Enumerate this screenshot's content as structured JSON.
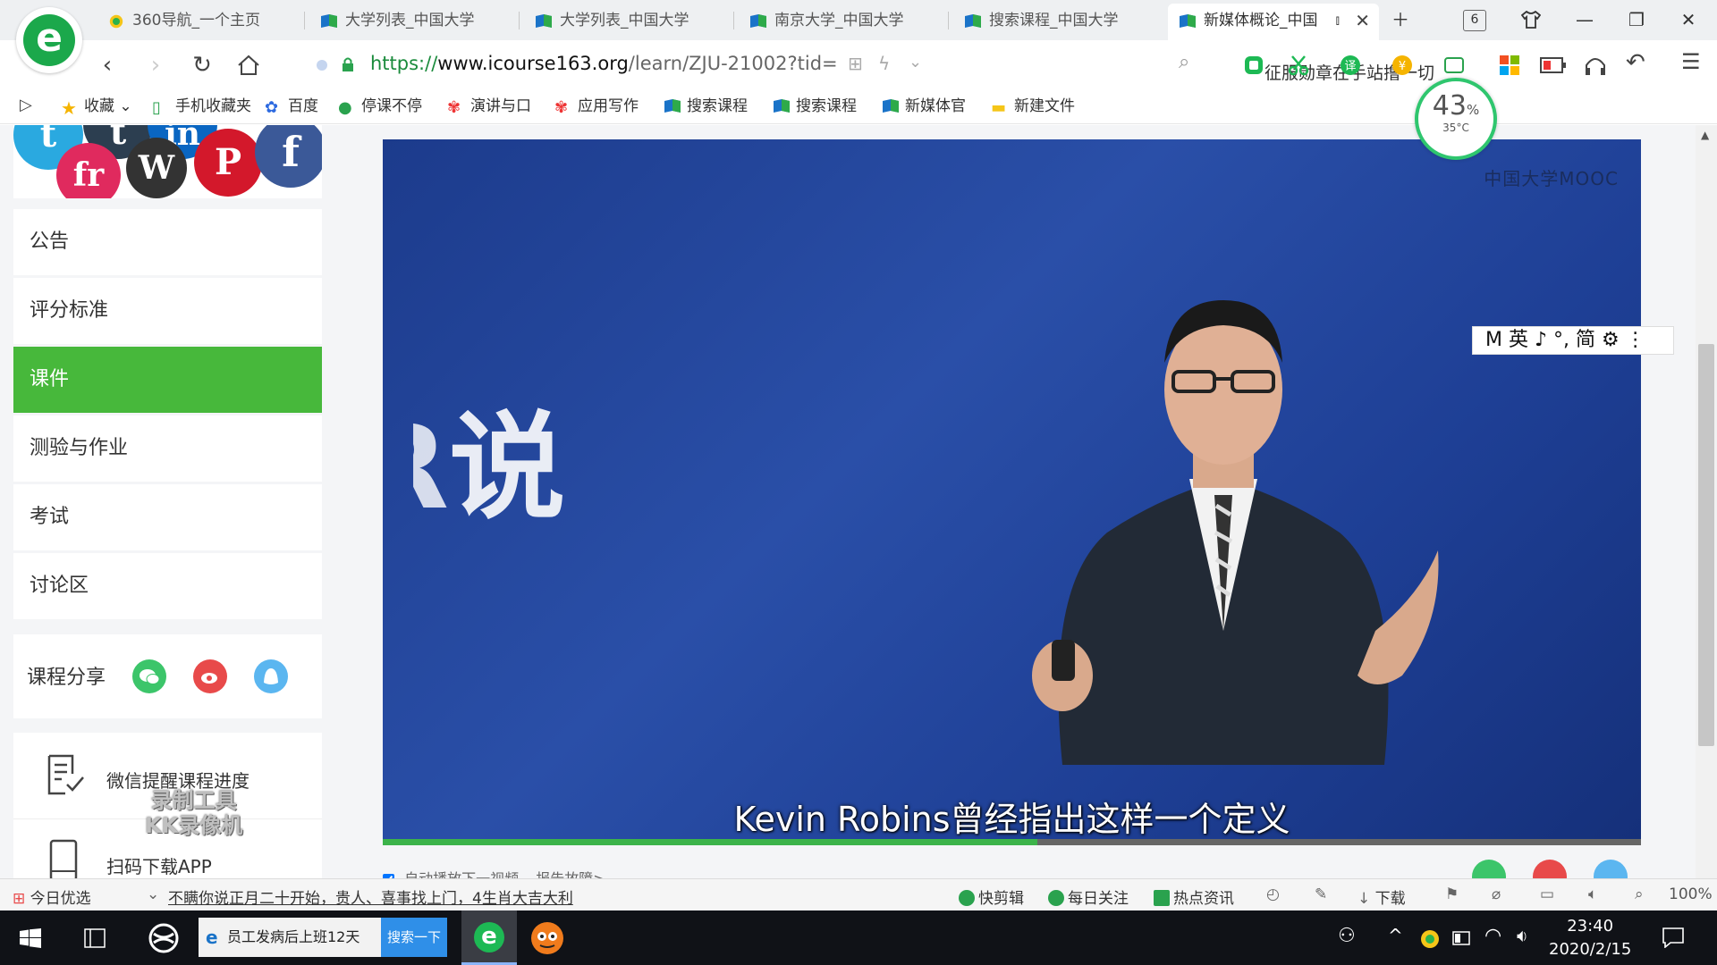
{
  "browser": {
    "tabs": [
      {
        "title": "360导航_一个主页",
        "active": false
      },
      {
        "title": "大学列表_中国大学",
        "active": false
      },
      {
        "title": "大学列表_中国大学",
        "active": false
      },
      {
        "title": "南京大学_中国大学",
        "active": false
      },
      {
        "title": "搜索课程_中国大学",
        "active": false
      },
      {
        "title": "新媒体概论_中国",
        "active": true
      }
    ],
    "tab_count": "6",
    "url_scheme": "https://",
    "url_host": "www.icourse163.org",
    "url_path": "/learn/ZJU-21002?tid=",
    "search_hint": "征服勋章在手站撸一切",
    "bookmarks": [
      "收藏",
      "手机收藏夹",
      "百度",
      "停课不停",
      "演讲与口",
      "应用写作",
      "搜索课程",
      "搜索课程",
      "新媒体官",
      "新建文件"
    ],
    "perf": {
      "percent": "43",
      "percent_sign": "%",
      "temp": "35°C"
    }
  },
  "sidebar": {
    "menu": [
      {
        "label": "公告",
        "active": false
      },
      {
        "label": "评分标准",
        "active": false
      },
      {
        "label": "课件",
        "active": true
      },
      {
        "label": "测验与作业",
        "active": false
      },
      {
        "label": "考试",
        "active": false
      },
      {
        "label": "讨论区",
        "active": false
      }
    ],
    "share_label": "课程分享",
    "wechat_remind": "微信提醒课程进度",
    "download_app": "扫码下载APP",
    "watermark_line1": "录制工具",
    "watermark_line2": "KK录像机"
  },
  "video": {
    "bg_text": "说",
    "bg_text_partial": "R",
    "logo": "中国大学MOOC",
    "subtitle": "Kevin Robins曾经指出这样一个定义",
    "progress": 0.52,
    "autoplay_label": "自动播放下一视频",
    "report_label": "报告故障>"
  },
  "ime": {
    "text": "M 英 ♪ °, 简 ⚙ ⋮"
  },
  "statusbar": {
    "today": "今日优选",
    "headline": "不瞒你说正月二十开始，贵人、喜事找上门，4生肖大吉大利",
    "items": [
      "快剪辑",
      "每日关注",
      "热点资讯",
      "下载"
    ],
    "zoom": "100%"
  },
  "taskbar": {
    "ie_title": "员工发病后上班12天",
    "search_btn": "搜索一下",
    "time": "23:40",
    "date": "2020/2/15"
  },
  "colors": {
    "accent_green": "#47b83b",
    "video_blue": "#2a4fa8"
  }
}
